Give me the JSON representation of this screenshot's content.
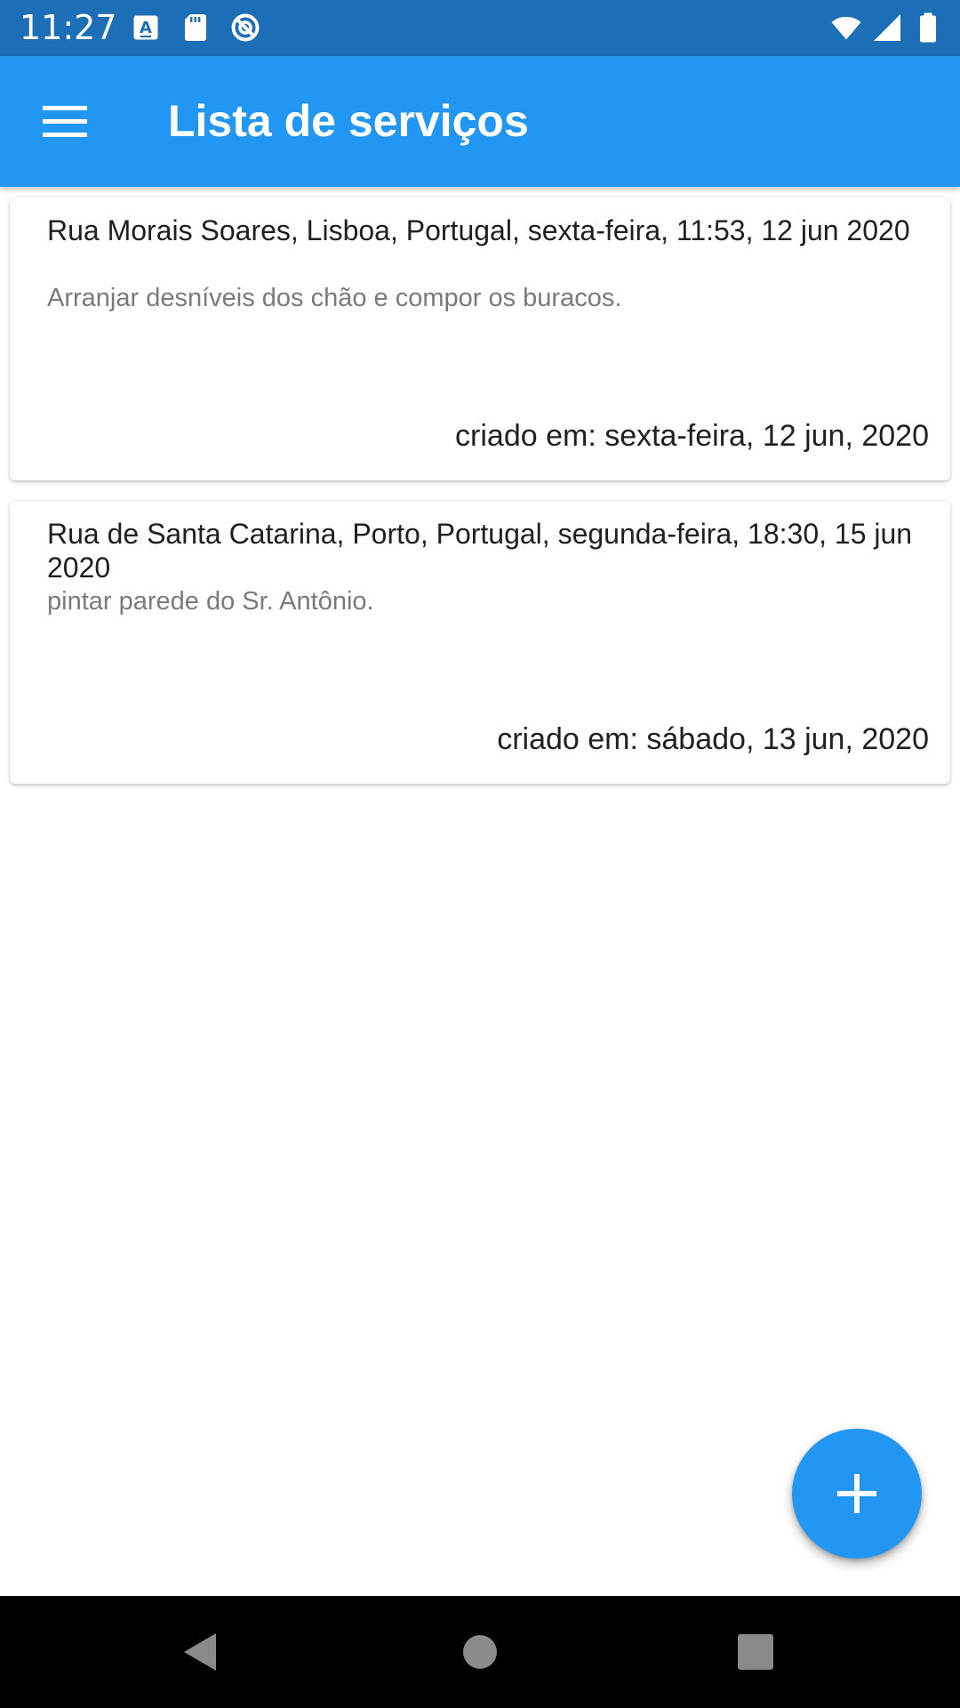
{
  "status_bar": {
    "time": "11:27",
    "icons_left": [
      "text-a-notification-icon",
      "sd-card-icon",
      "sync-disabled-icon"
    ],
    "icons_right": [
      "wifi-icon",
      "cell-signal-icon",
      "battery-icon"
    ]
  },
  "app_bar": {
    "title": "Lista de serviços",
    "menu_icon": "hamburger-menu-icon"
  },
  "services": [
    {
      "title": "Rua Morais Soares, Lisboa, Portugal, sexta-feira, 11:53, 12 jun 2020",
      "description": "Arranjar desníveis dos chão e compor os buracos.",
      "created": "criado em: sexta-feira, 12 jun, 2020"
    },
    {
      "title": "Rua de Santa Catarina, Porto, Portugal, segunda-feira, 18:30, 15 jun 2020",
      "description": "pintar parede do Sr. Antônio.",
      "created": "criado em: sábado, 13 jun, 2020"
    }
  ],
  "fab": {
    "icon": "plus-icon"
  },
  "nav_bar": {
    "icons": [
      "back-icon",
      "home-icon",
      "recents-icon"
    ]
  },
  "colors": {
    "status_bar": "#1c6fb6",
    "app_bar": "#2196f3",
    "fab": "#2196f3",
    "nav_bar": "#000000"
  }
}
